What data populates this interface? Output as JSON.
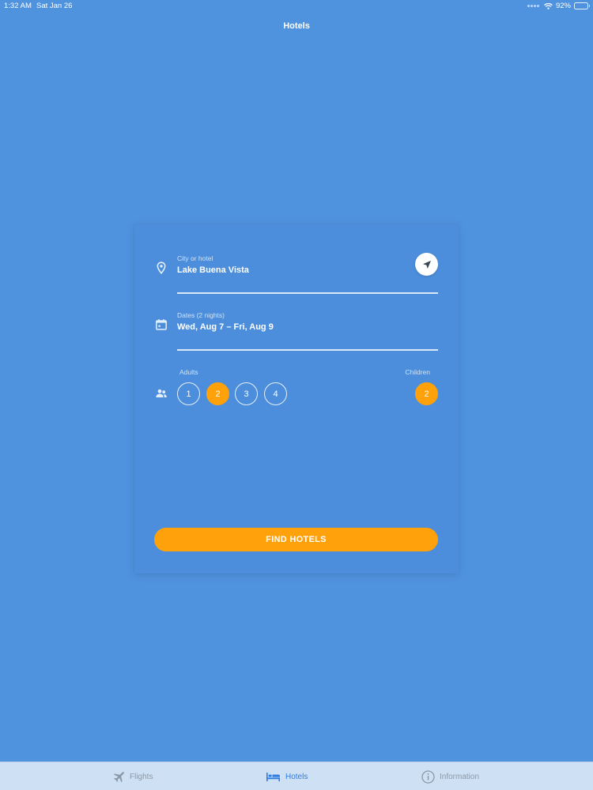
{
  "status_bar": {
    "time": "1:32 AM",
    "date": "Sat Jan 26",
    "battery": "92%",
    "battery_level": 0.92
  },
  "nav": {
    "title": "Hotels"
  },
  "search": {
    "location": {
      "label": "City or hotel",
      "value": "Lake Buena Vista",
      "icon": "location-pin-icon",
      "locate_icon": "navigation-arrow-icon"
    },
    "dates": {
      "label": "Dates (2 nights)",
      "value": "Wed, Aug 7 – Fri, Aug 9",
      "icon": "calendar-icon"
    },
    "guests": {
      "icon": "people-icon",
      "adults_label": "Adults",
      "adults_options": [
        "1",
        "2",
        "3",
        "4"
      ],
      "adults_selected": "2",
      "children_label": "Children",
      "children_value": "2"
    },
    "find_button": "FIND HOTELS"
  },
  "tab_bar": {
    "tabs": [
      {
        "label": "Flights",
        "icon": "airplane-icon",
        "active": false
      },
      {
        "label": "Hotels",
        "icon": "bed-icon",
        "active": true
      },
      {
        "label": "Information",
        "icon": "info-icon",
        "active": false
      }
    ]
  },
  "colors": {
    "background": "#4f92de",
    "accent": "#ffa10a",
    "tab_active": "#2f7be0",
    "tab_inactive": "#8c98a6",
    "tab_bar": "#cde0f4"
  }
}
